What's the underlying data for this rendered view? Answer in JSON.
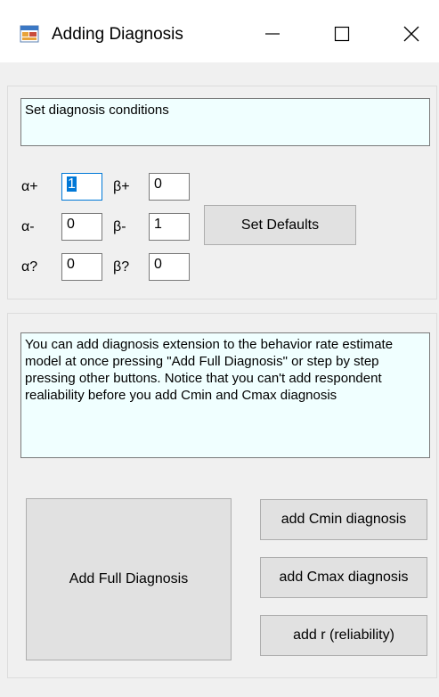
{
  "window": {
    "title": "Adding Diagnosis",
    "icon": "app-window-icon",
    "minimize_icon": "minimize-icon",
    "maximize_icon": "maximize-icon",
    "close_icon": "close-icon"
  },
  "conditions": {
    "header_text": "Set diagnosis conditions",
    "alpha_plus_label": "α+",
    "alpha_plus_value": "1",
    "beta_plus_label": "β+",
    "beta_plus_value": "0",
    "alpha_minus_label": "α-",
    "alpha_minus_value": "0",
    "beta_minus_label": "β-",
    "beta_minus_value": "1",
    "alpha_q_label": "α?",
    "alpha_q_value": "0",
    "beta_q_label": "β?",
    "beta_q_value": "0",
    "set_defaults_label": "Set Defaults"
  },
  "diagnosis": {
    "info_text": "You can add diagnosis extension to the behavior rate estimate model at once pressing \"Add Full Diagnosis\" or step by step pressing other buttons. Notice that you can't add respondent realiability before you add Cmin and Cmax diagnosis",
    "add_full_label": "Add Full Diagnosis",
    "add_cmin_label": "add Cmin diagnosis",
    "add_cmax_label": "add Cmax diagnosis",
    "add_r_label": "add r (reliability)"
  },
  "colors": {
    "textbox_background": "#f0ffff",
    "window_background": "#f0f0f0",
    "button_background": "#e1e1e1",
    "selection": "#0078d7"
  }
}
